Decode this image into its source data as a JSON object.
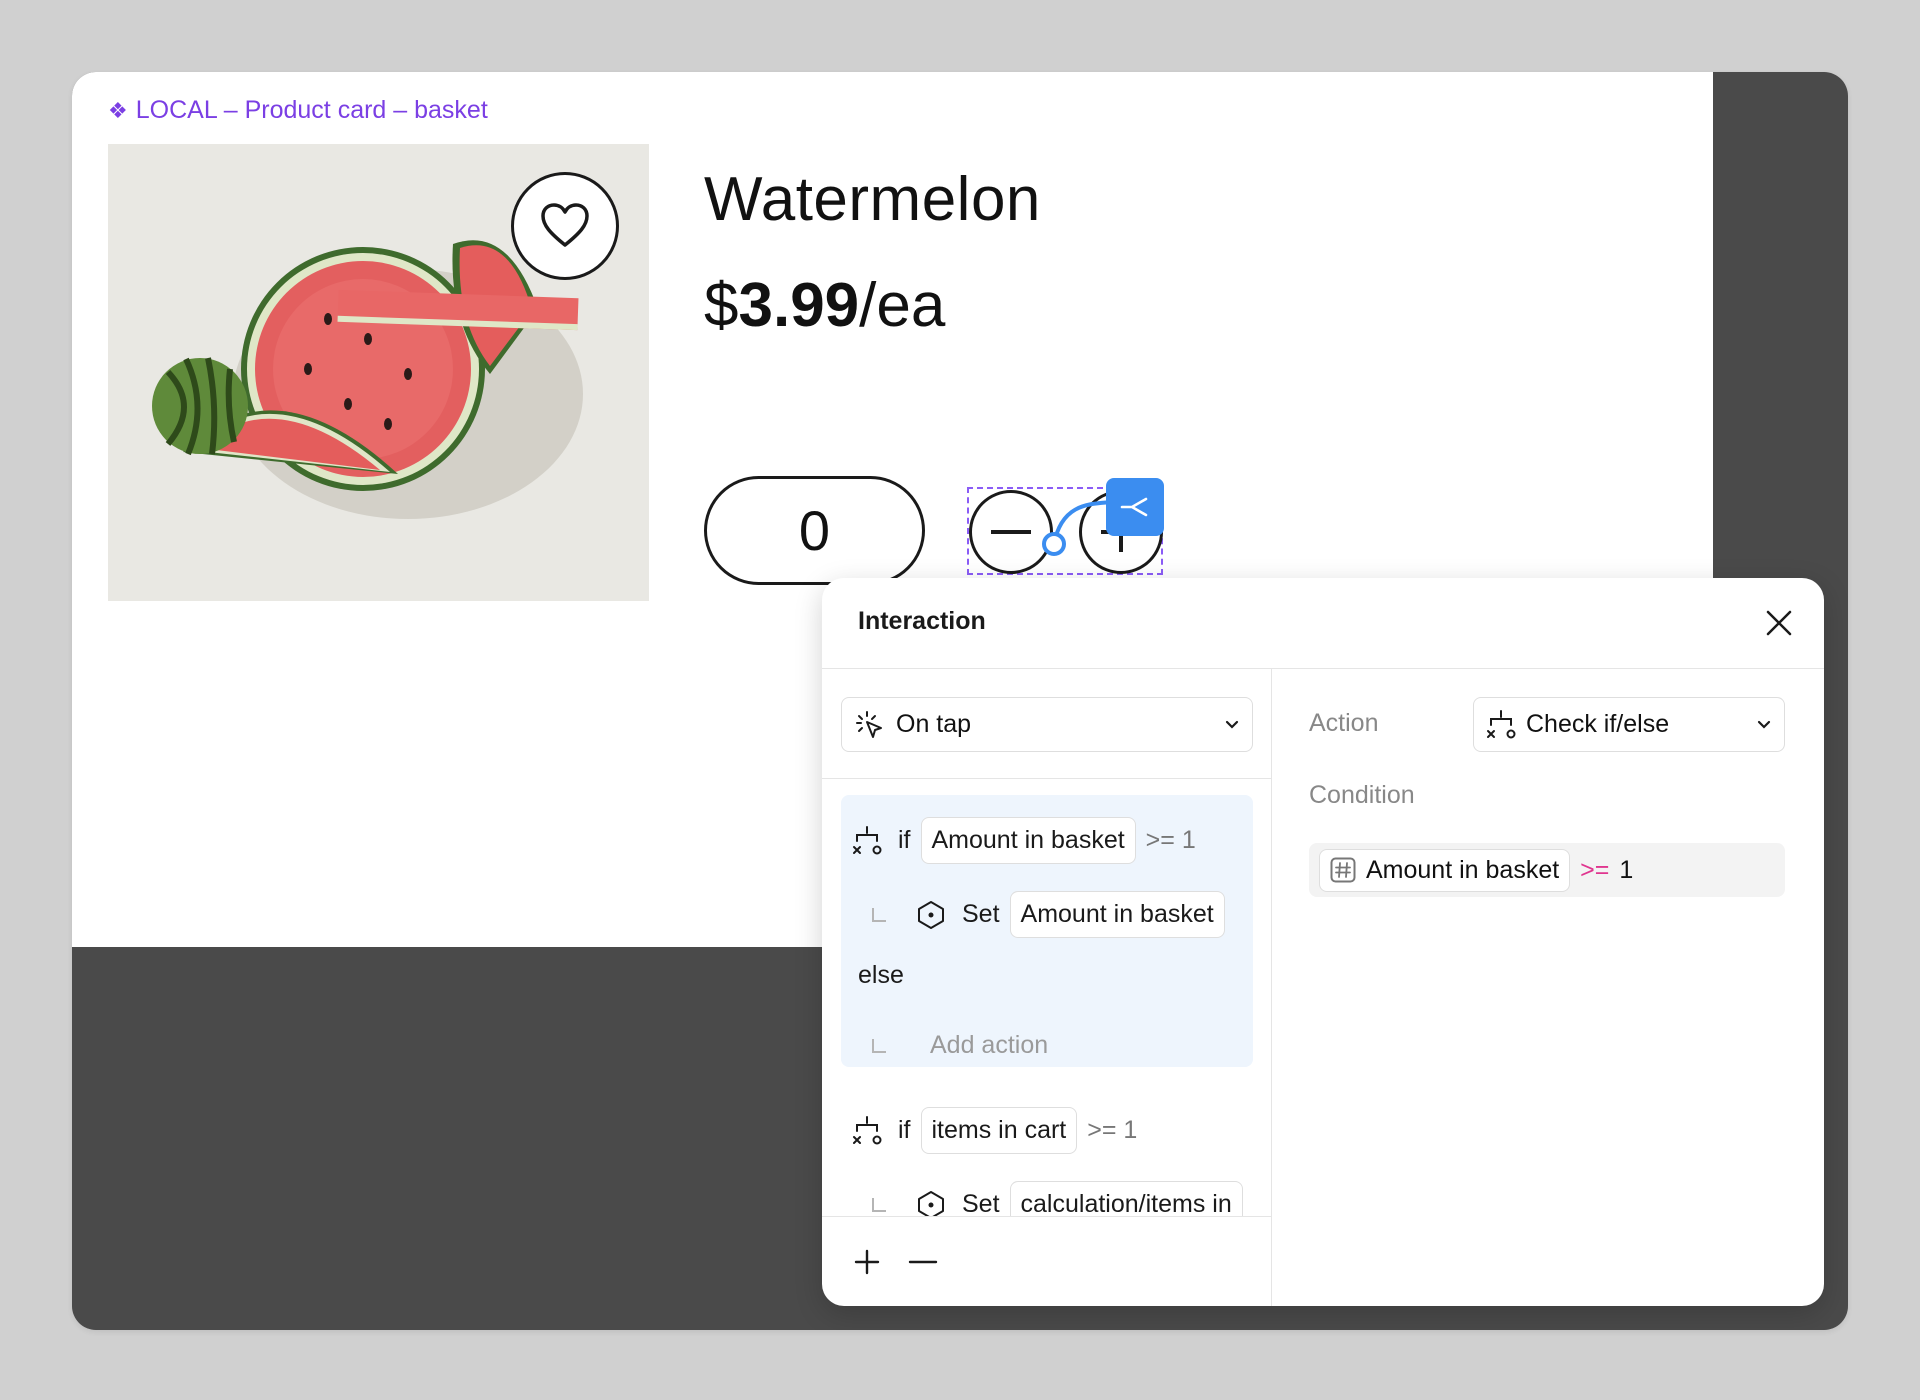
{
  "frame": {
    "label": "LOCAL – Product card – basket",
    "icon": "component-diamond-icon"
  },
  "product": {
    "name": "Watermelon",
    "price_symbol": "$",
    "price_amount": "3.99",
    "price_unit": "/ea",
    "quantity": "0",
    "image": "watermelon-slices-photo"
  },
  "panel": {
    "title": "Interaction",
    "trigger": {
      "label": "On tap",
      "icon": "tap-cursor-icon"
    },
    "action_label": "Action",
    "action_value": "Check if/else",
    "condition_label": "Condition",
    "condition": {
      "variable": "Amount in basket",
      "operator": ">=",
      "value": "1"
    },
    "list": {
      "block1": {
        "if_word": "if",
        "var": "Amount in basket",
        "op_val": ">= 1",
        "set_word": "Set",
        "set_var": "Amount in basket",
        "else_word": "else",
        "add_action": "Add action"
      },
      "block2": {
        "if_word": "if",
        "var": "items in cart",
        "op_val": ">= 1",
        "set_word": "Set",
        "set_var": "calculation/items in"
      }
    }
  },
  "colors": {
    "accent_purple": "#7b3fe4",
    "branch_blue": "#3b8df0",
    "operator_pink": "#e0358f",
    "highlight": "#eef5fd"
  }
}
